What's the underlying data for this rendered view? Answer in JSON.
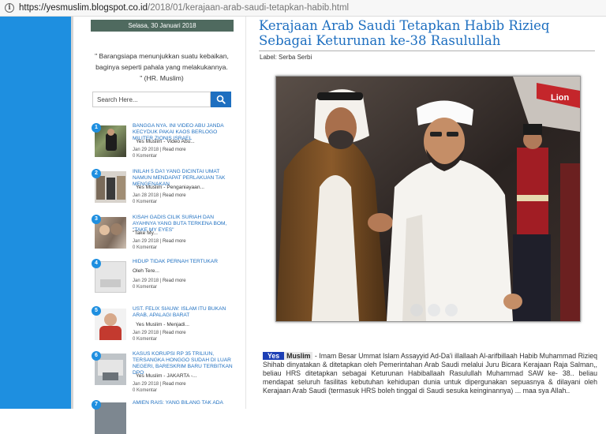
{
  "browser": {
    "url_host": "https://yesmuslim.blogspot.co.id",
    "url_path": "/2018/01/kerajaan-arab-saudi-tetapkan-habib.html"
  },
  "sidebar": {
    "date": "Selasa, 30 Januari 2018",
    "quote": "\" Barangsiapa menunjukkan suatu kebaikan, baginya seperti pahala yang melakukannya. \" (HR. Muslim)",
    "search_placeholder": "Search Here...",
    "posts": [
      {
        "num": "1",
        "title": "BANGGA NYA. INI VIDEO ABU JANDA KECYDUK PAKAI KAOS BERLOGO MILITER ZIONIS ISRAEL",
        "author": "Yes Muslim  -  Video Abu...",
        "date": "Jan 29 2018",
        "read_more": "Read more",
        "comments": "0 Komentar"
      },
      {
        "num": "2",
        "title": "INILAH 5 DA'I YANG DICINTAI UMAT NAMUN MENDAPAT PERLAKUAN TAK MENGENAKAN",
        "author": "Yes Muslim  -  Penganiayaan...",
        "date": "Jan 28 2018",
        "read_more": "Read more",
        "comments": "0 Komentar"
      },
      {
        "num": "3",
        "title": "KISAH GADIS CILIK SURIAH DAN AYAHNYA YANG BUTA TERKENA BOM, \"TAKE MY EYES\"",
        "author": "\"Take My...",
        "date": "Jan 29 2018",
        "read_more": "Read more",
        "comments": "0 Komentar"
      },
      {
        "num": "4",
        "title": "HIDUP TIDAK PERNAH TERTUKAR",
        "author": "Oleh Tere...",
        "date": "Jan 29 2018",
        "read_more": "Read more",
        "comments": "0 Komentar"
      },
      {
        "num": "5",
        "title": "UST. FELIX SIAUW: ISLAM ITU BUKAN ARAB, APALAGI BARAT",
        "author": "Yes Muslim  -  Menjadi...",
        "date": "Jan 29 2018",
        "read_more": "Read more",
        "comments": "0 Komentar"
      },
      {
        "num": "6",
        "title": "KASUS KORUPSI RP 35 TRILIUN, TERSANGKA HONGGO SUDAH DI LUAR NEGERI, BARESKRIM BARU TERBITKAN DPO",
        "author": "Yes Muslim  -  JAKARTA -...",
        "date": "Jan 29 2018",
        "read_more": "Read more",
        "comments": "0 Komentar"
      },
      {
        "num": "7",
        "title": "AMIEN RAIS: YANG BILANG TAK ADA",
        "author": "",
        "date": "",
        "read_more": "",
        "comments": ""
      }
    ]
  },
  "article": {
    "title": "Kerajaan Arab Saudi Tetapkan Habib Rizieq Sebagai Keturunan ke-38 Rasulullah",
    "label": "Label: Serba Serbi",
    "badge_yes": "Yes",
    "badge_muslim": "Muslim",
    "body": " - Imam Besar Ummat Islam Assayyid Ad-Da'i illallaah Al-arifbillaah Habib Muhammad Rizieq Shihab dinyatakan & ditetapkan oleh Pemerintahan Arab Saudi melalui Juru Bicara Kerajaan Raja Salman,, beliau HRS ditetapkan sebagai Keturunan Habiballaah Rasulullah Muhammad SAW ke- 38.. beliau mendapat seluruh fasilitas kebutuhan kehidupan dunia untuk dipergunakan sepuasnya & dilayani oleh Kerajaan Arab Saudi (termasuk HRS boleh tinggal di Saudi sesuka keinginannya) ... maa sya Allah..",
    "photo_sign": "Lion"
  },
  "colors": {
    "accent": "#1e8fe0",
    "link": "#1e6fc0",
    "datebar": "#4f6a5f",
    "badge": "#1c3fb5"
  }
}
